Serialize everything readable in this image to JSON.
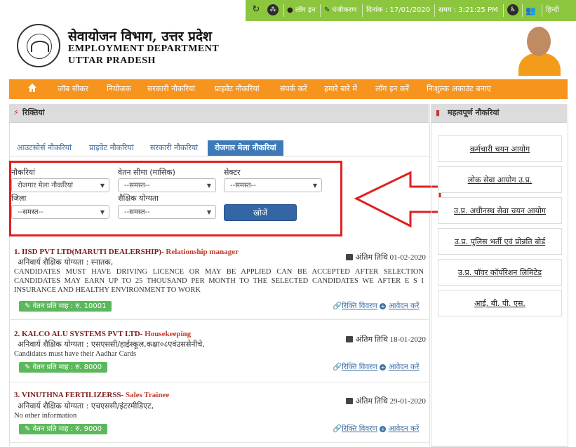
{
  "topbar": {
    "login": "लॉग इन",
    "register": "पंजीकरण",
    "date_label": "दिनांक :",
    "date_value": "17/01/2020",
    "time_label": "समय :",
    "time_value": "3:21:25 PM",
    "language": "हिन्दी"
  },
  "header": {
    "title_hi": "सेवायोजन विभाग, उत्तर प्रदेश",
    "title_en_1": "EMPLOYMENT DEPARTMENT",
    "title_en_2": "UTTAR PRADESH"
  },
  "nav": {
    "items": [
      "जॉब सीकर",
      "नियोजक",
      "सरकारी नौकरियां",
      "प्राइवेट नौकरियां",
      "संपर्क करें",
      "हमारे बारे में",
      "लॉग इन करें",
      "निःशुल्क अकाउंट बनाए"
    ]
  },
  "vacancies": {
    "heading": "रिक्तियां",
    "tabs": [
      "आउटसोर्स नौकरियां",
      "प्राइवेट नौकरियां",
      "सरकारी नौकरियां",
      "रोजगार मेला नौकरियां"
    ],
    "filters": {
      "jobs_label": "नौकरियां",
      "jobs_value": "रोजगार मेला नौकरियां",
      "salary_label": "वेतन सीमा (मासिक)",
      "salary_value": "--समस्त--",
      "sector_label": "सेक्टर",
      "sector_value": "--समस्त--",
      "district_label": "जिला",
      "district_value": "--समस्त--",
      "edu_label": "शैक्षिक योग्यता",
      "edu_value": "--समस्त--",
      "search_label": "खोजें"
    }
  },
  "jobs": [
    {
      "num": "1.",
      "company": "IISD PVT LTD(MARUTI DEALERSHIP)-",
      "role": "Relationship manager",
      "qual": "अनिवार्य शैक्षिक योग्यता : स्नातक,",
      "desc": "CANDIDATES MUST HAVE DRIVING LICENCE OR MAY BE APPLIED CAN BE ACCEPTED AFTER SELECTION CANDIDATES MAY EARN UP TO 25 THOUSAND PER MONTH TO THE SELECTED CANDIDATES WE AFTER E S I INSURANCE AND HEALTHY ENVIRONMENT TO WORK",
      "deadline": "अंतिम तिथि 01-02-2020",
      "pay": "वेतन प्रति माह : रु. 10001",
      "details": "रिक्ति विवरण",
      "apply": "आवेदन करें"
    },
    {
      "num": "2.",
      "company": "KALCO ALU SYSTEMS PVT LTD-",
      "role": "Housekeeping",
      "qual": "अनिवार्य शैक्षिक योग्यता : एसएससी/हाईस्कूल,कक्षा०८एवंउससेनीचे,",
      "desc": "Candidates must have their Aadhar Cards",
      "deadline": "अंतिम तिथि 18-01-2020",
      "pay": "वेतन प्रति माह : रु. 8000",
      "details": "रिक्ति विवरण",
      "apply": "आवेदन करें"
    },
    {
      "num": "3.",
      "company": "VINUTHNA FERTILIZERSS-",
      "role": "Sales Trainee",
      "qual": "अनिवार्य शैक्षिक योग्यता : एचएससी/इंटरमीडिएट,",
      "desc": "No other information",
      "deadline": "अंतिम तिथि 29-01-2020",
      "pay": "वेतन प्रति माह : रु. 9000",
      "details": "रिक्ति विवरण",
      "apply": "आवेदन करें"
    }
  ],
  "important": {
    "heading": "महत्वपूर्ण नौकरियां",
    "links": [
      "कर्मचारी चयन आयोग",
      "लोक सेवा आयोग उ.प्र.",
      "उ.प्र. अधीनस्थ सेवा चयन आयोग",
      "उ.प्र. पुलिस भर्ती एवं प्रोन्नति बोर्ड",
      "उ.प्र. पॉवर कॉर्पोरेशन लिमिटेड",
      "आई. बी. पी. एस."
    ]
  },
  "colors": {
    "topbar": "#8cc63f",
    "nav": "#f7941d",
    "active_tab": "#3f7ab8",
    "annotation_red": "#e02020",
    "pay_badge": "#5cb85c"
  }
}
